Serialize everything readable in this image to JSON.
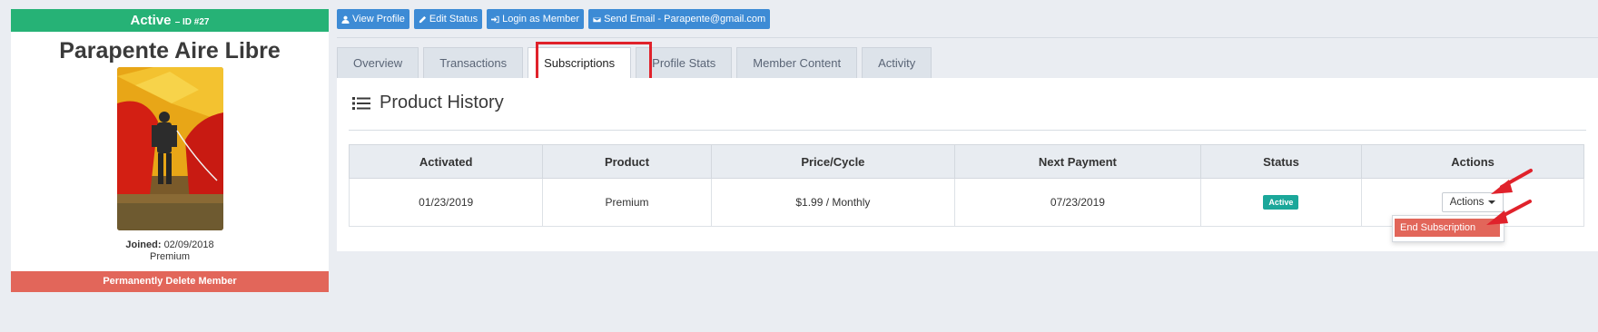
{
  "member": {
    "status": "Active",
    "id_label": "– ID #27",
    "name": "Parapente Aire Libre",
    "joined_label": "Joined:",
    "joined_date": "02/09/2018",
    "plan": "Premium",
    "delete_label": "Permanently Delete Member"
  },
  "toolbar": {
    "buttons": [
      {
        "label": "View Profile",
        "icon": "user-icon"
      },
      {
        "label": "Edit Status",
        "icon": "pencil-icon"
      },
      {
        "label": "Login as Member",
        "icon": "sign-in-icon"
      },
      {
        "label": "Send Email - Parapente@gmail.com",
        "icon": "envelope-icon"
      }
    ]
  },
  "tabs": [
    {
      "label": "Overview",
      "active": false
    },
    {
      "label": "Transactions",
      "active": false
    },
    {
      "label": "Subscriptions",
      "active": true
    },
    {
      "label": "Profile Stats",
      "active": false
    },
    {
      "label": "Member Content",
      "active": false
    },
    {
      "label": "Activity",
      "active": false
    }
  ],
  "panel": {
    "title": "Product History",
    "title_icon": "list-icon"
  },
  "table": {
    "headers": [
      "Activated",
      "Product",
      "Price/Cycle",
      "Next Payment",
      "Status",
      "Actions"
    ],
    "rows": [
      {
        "activated": "01/23/2019",
        "product": "Premium",
        "price_cycle": "$1.99 / Monthly",
        "next_payment": "07/23/2019",
        "status": "Active",
        "actions_label": "Actions"
      }
    ]
  },
  "dropdown": {
    "items": [
      "End Subscription"
    ]
  },
  "colors": {
    "status_active": "#26b276",
    "primary_button": "#3d8bd5",
    "danger": "#e2665a",
    "badge_active": "#1ba79a",
    "annotation": "#e0222b"
  }
}
